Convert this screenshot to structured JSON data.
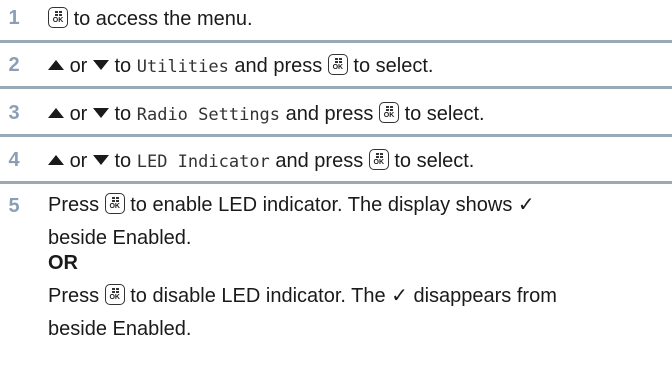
{
  "steps": [
    {
      "number": "1",
      "text_after_button": "to access the menu."
    },
    {
      "number": "2",
      "or": "or",
      "to": "to",
      "target": "Utilities",
      "and_press": "and press",
      "to_select": "to select."
    },
    {
      "number": "3",
      "or": "or",
      "to": "to",
      "target": "Radio Settings",
      "and_press": "and press",
      "to_select": "to select."
    },
    {
      "number": "4",
      "or": "or",
      "to": "to",
      "target": "LED Indicator",
      "and_press": "and press",
      "to_select": "to select."
    },
    {
      "number": "5",
      "press": "Press",
      "enable_text": "to enable LED indicator. The display shows ✓",
      "enable_text_cont": "beside Enabled.",
      "or_label": "OR",
      "disable_text": "to disable LED indicator. The ✓ disappears from",
      "disable_text_cont": "beside Enabled."
    }
  ],
  "icons": {
    "ok_button": "menu-ok-button-icon",
    "up": "up-arrow-icon",
    "down": "down-arrow-icon"
  },
  "ok_label": "OK",
  "colors": {
    "step_number": "#8a9fb6",
    "separator": "#9aa9b8",
    "text": "#1a1a1a"
  }
}
